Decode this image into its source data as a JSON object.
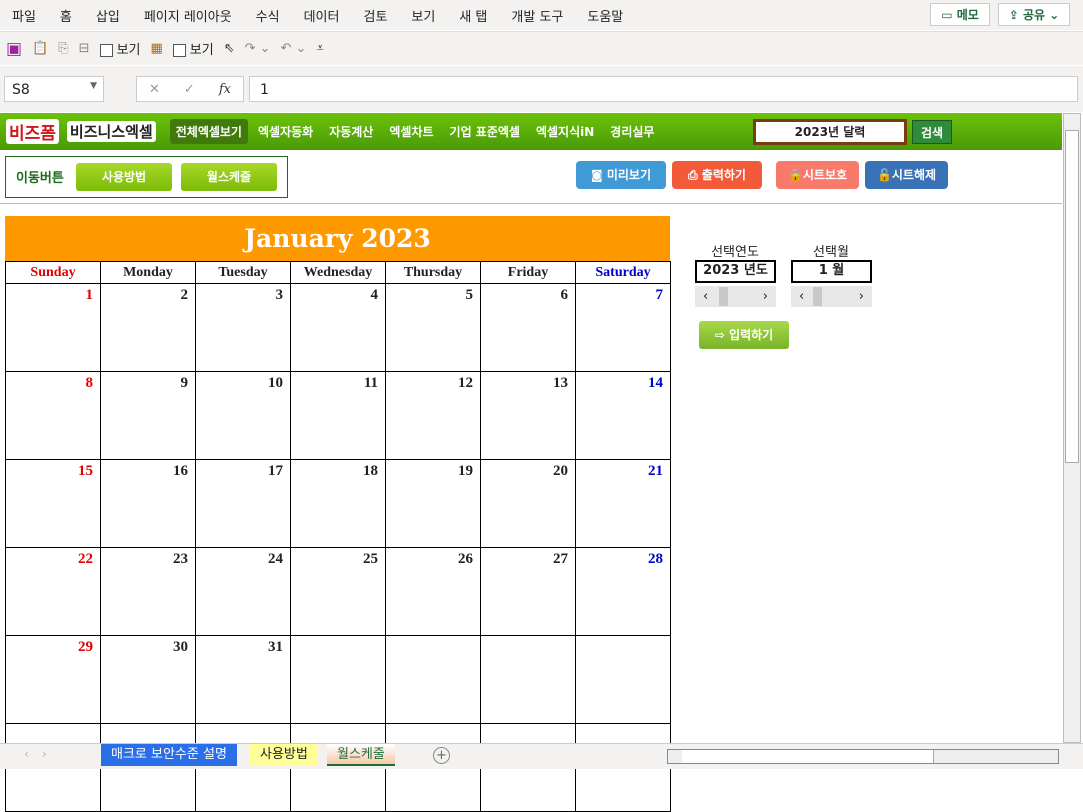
{
  "menu": [
    "파일",
    "홈",
    "삽입",
    "페이지 레이아웃",
    "수식",
    "데이터",
    "검토",
    "보기",
    "새 탭",
    "개발 도구",
    "도움말"
  ],
  "memo": "메모",
  "share": "공유",
  "qat": {
    "view1": "보기",
    "view2": "보기"
  },
  "namebox": "S8",
  "formula": "1",
  "nav": {
    "logo": "비즈폼",
    "logo2": "비즈니스엑셀",
    "items": [
      "전체엑셀보기",
      "엑셀자동화",
      "자동계산",
      "엑셀차트",
      "기업 표준엑셀",
      "엑셀지식iN",
      "경리실무"
    ],
    "search": "2023년 달력",
    "search_btn": "검색"
  },
  "move": {
    "label": "이동버튼",
    "btn1": "사용방법",
    "btn2": "월스케줄"
  },
  "tools": {
    "preview": "미리보기",
    "print": "출력하기",
    "protect": "시트보호",
    "unprotect": "시트해제"
  },
  "calendar": {
    "title": "January 2023",
    "days": [
      "Sunday",
      "Monday",
      "Tuesday",
      "Wednesday",
      "Thursday",
      "Friday",
      "Saturday"
    ],
    "weeks": [
      [
        "1",
        "2",
        "3",
        "4",
        "5",
        "6",
        "7"
      ],
      [
        "8",
        "9",
        "10",
        "11",
        "12",
        "13",
        "14"
      ],
      [
        "15",
        "16",
        "17",
        "18",
        "19",
        "20",
        "21"
      ],
      [
        "22",
        "23",
        "24",
        "25",
        "26",
        "27",
        "28"
      ],
      [
        "29",
        "30",
        "31",
        "",
        "",
        "",
        ""
      ]
    ]
  },
  "selector": {
    "year_label": "선택연도",
    "year_value": "2023 년도",
    "month_label": "선택월",
    "month_value": "1 월",
    "input_btn": "입력하기"
  },
  "sheets": [
    "매크로 보안수준 설명",
    "사용방법",
    "월스케줄"
  ]
}
